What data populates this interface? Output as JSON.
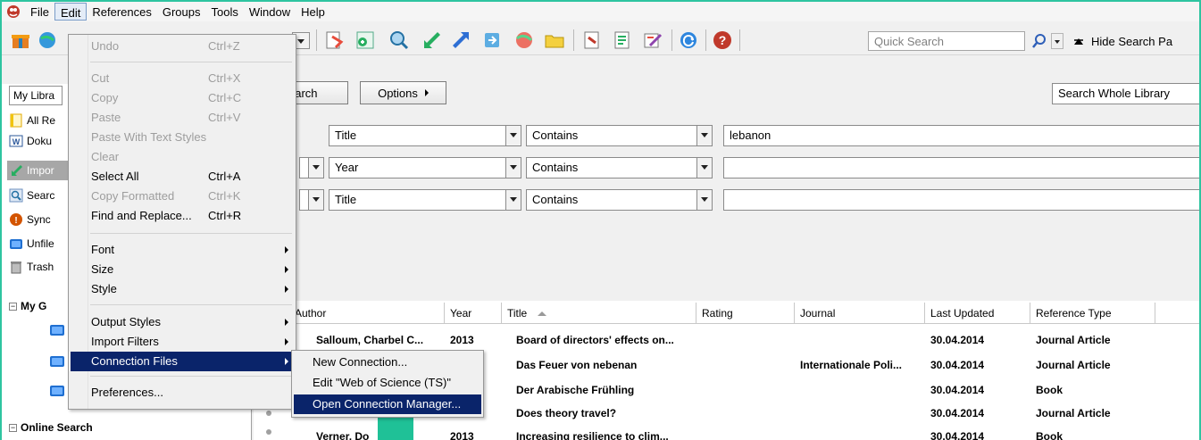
{
  "colors": {
    "frame": "#2ec4a0",
    "menu_highlight": "#0a246a",
    "green_block": "#1fc197"
  },
  "menubar": {
    "items": [
      "File",
      "Edit",
      "References",
      "Groups",
      "Tools",
      "Window",
      "Help"
    ]
  },
  "toolbar": {
    "quick_search_placeholder": "Quick Search",
    "hide_search_label": "Hide Search Pa",
    "icons": [
      "online-search-icon",
      "new-reference-icon",
      "find-full-text-icon",
      "import-icon",
      "export-icon",
      "open-link-icon",
      "find-icon",
      "folder-icon",
      "cite-while-you-write-icon",
      "format-bibliography-icon",
      "edit-reference-icon",
      "sync-icon",
      "help-icon"
    ]
  },
  "library": {
    "tab_label": "My Libra",
    "items": [
      {
        "icon": "all-references-icon",
        "label": "All Re"
      },
      {
        "icon": "word-doc-icon",
        "label": "Doku"
      },
      {
        "icon": "imported-icon",
        "label": "Impor",
        "selected": true
      },
      {
        "icon": "search-results-icon",
        "label": "Searc"
      },
      {
        "icon": "sync-status-icon",
        "label": "Sync"
      },
      {
        "icon": "unfiled-icon",
        "label": "Unfile"
      },
      {
        "icon": "trash-icon",
        "label": "Trash"
      }
    ],
    "groups_header": "My G",
    "online_search_header": "Online Search"
  },
  "search_panel": {
    "search_button_label": "earch",
    "options_label": "Options",
    "scope_value": "Search Whole Library",
    "rows": [
      {
        "field": "Title",
        "operator": "Contains",
        "value": "lebanon"
      },
      {
        "field": "Year",
        "operator": "Contains",
        "value": ""
      },
      {
        "field": "Title",
        "operator": "Contains",
        "value": ""
      }
    ]
  },
  "ref_list": {
    "columns": [
      "Author",
      "Year",
      "Title",
      "Rating",
      "Journal",
      "Last Updated",
      "Reference Type"
    ],
    "rows": [
      {
        "author": "Salloum, Charbel C...",
        "year": "2013",
        "title": "Board of directors' effects on...",
        "rating": "",
        "journal": "",
        "updated": "30.04.2014",
        "type": "Journal Article"
      },
      {
        "author": "",
        "year": "",
        "title": "Das Feuer von nebenan",
        "rating": "",
        "journal": "Internationale Poli...",
        "updated": "30.04.2014",
        "type": "Journal Article"
      },
      {
        "author": "",
        "year": "",
        "title": "Der Arabische Frühling",
        "rating": "",
        "journal": "",
        "updated": "30.04.2014",
        "type": "Book"
      },
      {
        "author": "",
        "year": "",
        "title": "Does theory travel?",
        "rating": "",
        "journal": "",
        "updated": "30.04.2014",
        "type": "Journal Article"
      },
      {
        "author": "Verner, Do",
        "year": "2013",
        "title": "Increasing resilience to clim...",
        "rating": "",
        "journal": "",
        "updated": "30.04.2014",
        "type": "Book"
      }
    ]
  },
  "edit_menu": {
    "items": [
      {
        "label": "Undo",
        "shortcut": "Ctrl+Z",
        "disabled": true
      },
      {
        "label": "Cut",
        "shortcut": "Ctrl+X",
        "disabled": true
      },
      {
        "label": "Copy",
        "shortcut": "Ctrl+C",
        "disabled": true
      },
      {
        "label": "Paste",
        "shortcut": "Ctrl+V",
        "disabled": true
      },
      {
        "label": "Paste With Text Styles",
        "shortcut": "",
        "disabled": true
      },
      {
        "label": "Clear",
        "shortcut": "",
        "disabled": true
      },
      {
        "label": "Select All",
        "shortcut": "Ctrl+A",
        "disabled": false
      },
      {
        "label": "Copy Formatted",
        "shortcut": "Ctrl+K",
        "disabled": true
      },
      {
        "label": "Find and Replace...",
        "shortcut": "Ctrl+R",
        "disabled": false
      },
      {
        "label": "Font",
        "shortcut": "",
        "submenu": true
      },
      {
        "label": "Size",
        "shortcut": "",
        "submenu": true
      },
      {
        "label": "Style",
        "shortcut": "",
        "submenu": true
      },
      {
        "label": "Output Styles",
        "shortcut": "",
        "submenu": true
      },
      {
        "label": "Import Filters",
        "shortcut": "",
        "submenu": true
      },
      {
        "label": "Connection Files",
        "shortcut": "",
        "submenu": true,
        "highlighted": true
      },
      {
        "label": "Preferences...",
        "shortcut": ""
      }
    ]
  },
  "connection_submenu": {
    "items": [
      {
        "label": "New Connection..."
      },
      {
        "label": "Edit \"Web of Science (TS)\""
      },
      {
        "label": "Open Connection Manager...",
        "highlighted": true
      }
    ]
  }
}
